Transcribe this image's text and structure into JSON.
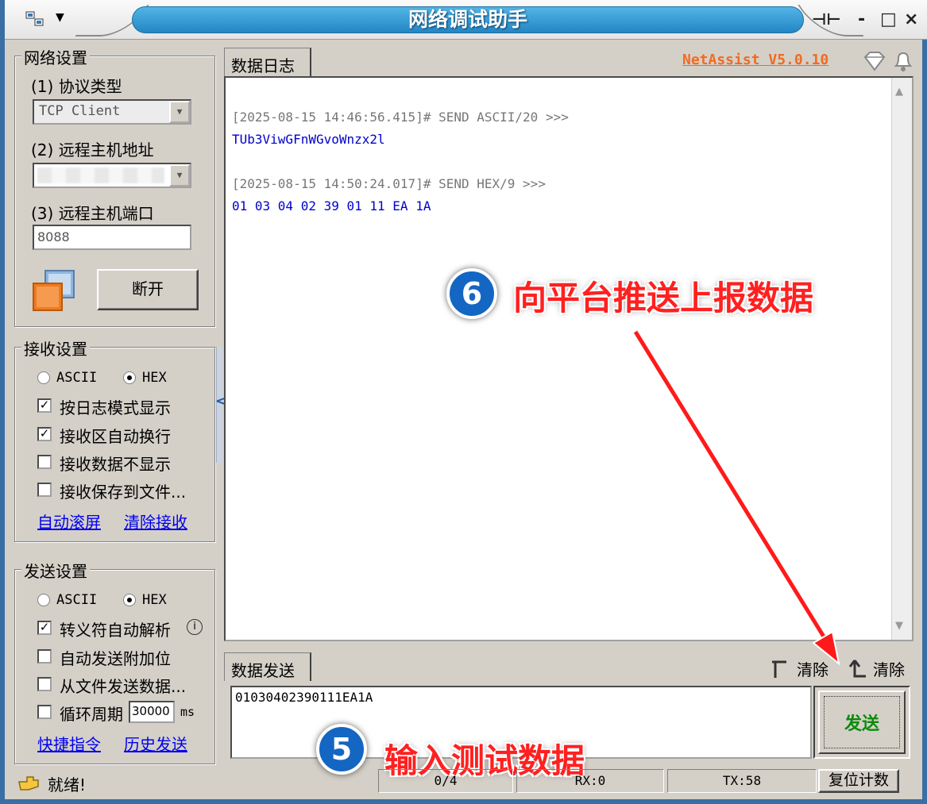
{
  "window": {
    "title": "网络调试助手"
  },
  "net_settings": {
    "title": "网络设置",
    "protocol_label": "(1) 协议类型",
    "protocol_value": "TCP Client",
    "host_label": "(2) 远程主机地址",
    "port_label": "(3) 远程主机端口",
    "port_value": "8088",
    "disconnect_label": "断开"
  },
  "recv_settings": {
    "title": "接收设置",
    "ascii": "ASCII",
    "hex": "HEX",
    "selected": "HEX",
    "opt_log_mode": "按日志模式显示",
    "opt_auto_wrap": "接收区自动换行",
    "opt_no_display": "接收数据不显示",
    "opt_save_file": "接收保存到文件...",
    "link_auto_scroll": "自动滚屏",
    "link_clear_recv": "清除接收"
  },
  "send_settings": {
    "title": "发送设置",
    "ascii": "ASCII",
    "hex": "HEX",
    "selected": "HEX",
    "opt_escape": "转义符自动解析",
    "opt_append_bit": "自动发送附加位",
    "opt_from_file": "从文件发送数据...",
    "opt_loop": "循环周期",
    "loop_value": "30000",
    "loop_unit": "ms",
    "link_shortcuts": "快捷指令",
    "link_history": "历史发送"
  },
  "log": {
    "tab_label": "数据日志",
    "brand": "NetAssist V5.0.10",
    "entries": [
      {
        "meta": "[2025-08-15 14:46:56.415]# SEND ASCII/20 >>>",
        "data": "TUb3ViwGFnWGvoWnzx2l"
      },
      {
        "meta": "[2025-08-15 14:50:24.017]# SEND HEX/9 >>>",
        "data": "01 03 04 02 39 01 11 EA 1A"
      }
    ]
  },
  "send": {
    "tab_label": "数据发送",
    "clear_left": "清除",
    "clear_right": "清除",
    "input_value": "01030402390111EA1A",
    "send_button": "发送"
  },
  "status": {
    "ready": "就绪!",
    "count": "0/4",
    "rx": "RX:0",
    "tx": "TX:58",
    "reset_label": "复位计数"
  },
  "annotations": {
    "step6_num": "6",
    "step6_text": "向平台推送上报数据",
    "step5_num": "5",
    "step5_text": "输入测试数据"
  },
  "colors": {
    "accent": "#2386c4",
    "annotation": "#ff2020",
    "badge": "#1466c3",
    "brand": "#f26a21",
    "send_text": "#0d8a0d",
    "log_data": "#0000cc"
  }
}
